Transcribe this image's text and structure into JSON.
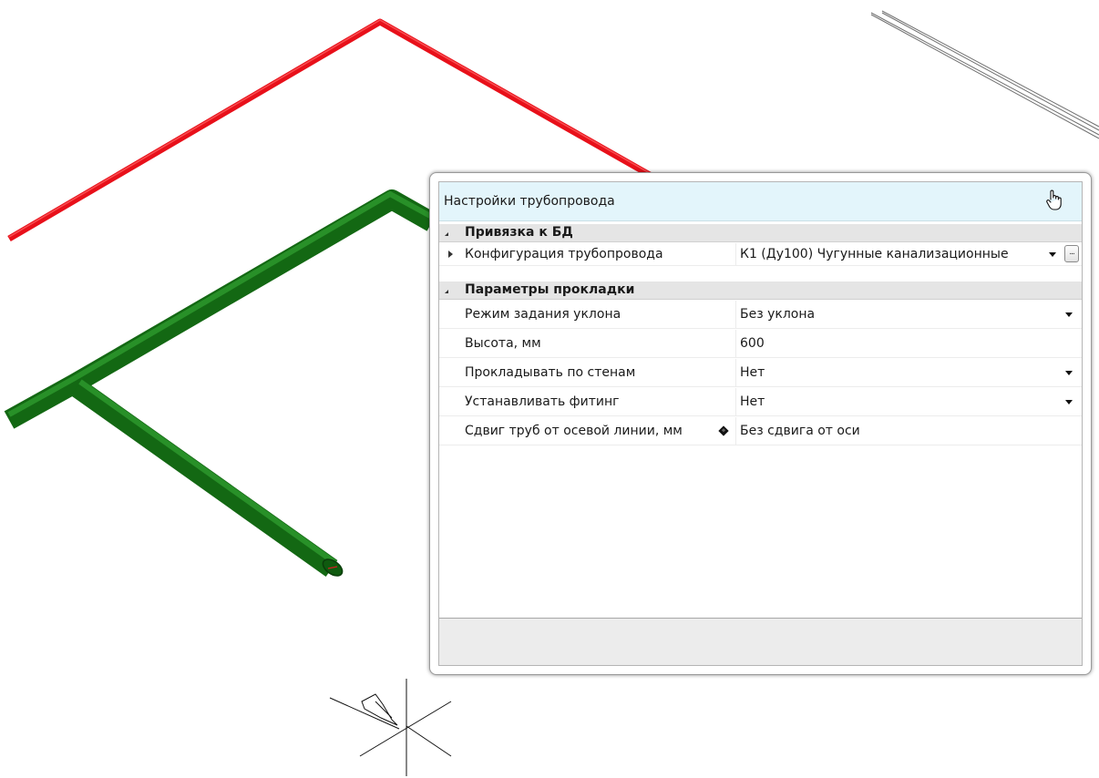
{
  "panel": {
    "title": "Настройки трубопровода"
  },
  "categories": [
    {
      "label": "Привязка к БД",
      "properties": [
        {
          "name": "Конфигурация трубопровода",
          "value": "К1 (Ду100) Чугунные канализационные",
          "button_label": "..."
        }
      ]
    },
    {
      "label": "Параметры прокладки",
      "properties": [
        {
          "name": "Режим задания уклона",
          "value": "Без уклона"
        },
        {
          "name": "Высота, мм",
          "value": "600"
        },
        {
          "name": "Прокладывать по стенам",
          "value": "Нет"
        },
        {
          "name": "Устанавливать фитинг",
          "value": "Нет"
        },
        {
          "name": "Сдвиг труб от осевой линии, мм",
          "value": "Без сдвига от оси"
        }
      ]
    }
  ],
  "colors": {
    "pipe_red": "#e8101a",
    "pipe_green": "#1a7a1a",
    "header_bg": "#e3f5fb",
    "category_bg": "#e5e5e5",
    "status_bg": "#ececec"
  },
  "icons": {
    "header": "hand-pointer-icon",
    "expander": "triangle-expander-icon",
    "dropdown": "chevron-down-icon",
    "override": "diamond-icon",
    "cursor": "ucs-crosshair-icon"
  }
}
